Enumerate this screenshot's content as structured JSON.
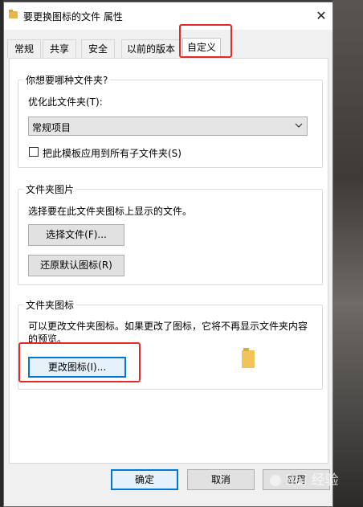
{
  "window": {
    "title": "要更换图标的文件 属性",
    "close_symbol": "✕"
  },
  "tabs": [
    {
      "label": "常规"
    },
    {
      "label": "共享"
    },
    {
      "label": "安全"
    },
    {
      "label": "以前的版本"
    },
    {
      "label": "自定义",
      "active": true
    }
  ],
  "folder_type": {
    "group_label": "你想要哪种文件夹?",
    "optimize_label": "优化此文件夹(T):",
    "selected_value": "常规项目",
    "apply_template_label": "把此模板应用到所有子文件夹(S)",
    "apply_template_checked": false
  },
  "folder_pictures": {
    "group_label": "文件夹图片",
    "description": "选择要在此文件夹图标上显示的文件。",
    "choose_file_label": "选择文件(F)...",
    "restore_default_label": "还原默认图标(R)"
  },
  "folder_icons": {
    "group_label": "文件夹图标",
    "description": "可以更改文件夹图标。如果更改了图标，它将不再显示文件夹内容的预览。",
    "change_icon_label": "更改图标(I)..."
  },
  "footer": {
    "ok_label": "确定",
    "cancel_label": "取消",
    "apply_label": "应用"
  },
  "watermark": {
    "text": "Bai 经验"
  },
  "colors": {
    "highlight_red": "#e32a2a",
    "folder_yellow": "#f2c35a",
    "accent_blue": "#0078d7"
  },
  "icons": [
    "folder-icon",
    "close-icon",
    "chevron-down-icon"
  ]
}
